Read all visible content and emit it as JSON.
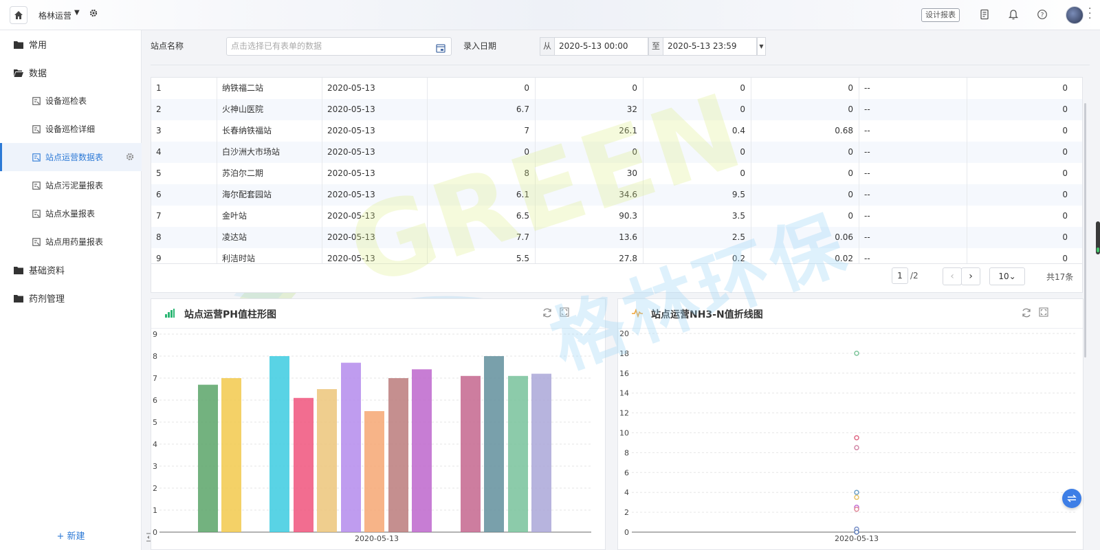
{
  "topbar": {
    "app_name": "格林运营",
    "design_report_label": "设计报表"
  },
  "sidebar": {
    "groups": [
      {
        "label": "常用",
        "icon": "folder-icon"
      },
      {
        "label": "数据",
        "icon": "folder-open-icon"
      },
      {
        "label": "基础资料",
        "icon": "folder-icon"
      },
      {
        "label": "药剂管理",
        "icon": "folder-icon"
      }
    ],
    "items": [
      {
        "label": "设备巡检表",
        "active": false
      },
      {
        "label": "设备巡检详细",
        "active": false
      },
      {
        "label": "站点运营数据表",
        "active": true
      },
      {
        "label": "站点污泥量报表",
        "active": false
      },
      {
        "label": "站点水量报表",
        "active": false
      },
      {
        "label": "站点用药量报表",
        "active": false
      }
    ],
    "new_label": "+ 新建"
  },
  "filter": {
    "station_label": "站点名称",
    "station_placeholder": "点击选择已有表单的数据",
    "date_label": "录入日期",
    "from_prefix": "从",
    "from_value": "2020-5-13 00:00",
    "to_prefix": "至",
    "to_value": "2020-5-13 23:59"
  },
  "table": {
    "rows": [
      [
        "1",
        "纳铁福二站",
        "2020-05-13",
        "0",
        "0",
        "0",
        "0",
        "--",
        "0"
      ],
      [
        "2",
        "火神山医院",
        "2020-05-13",
        "6.7",
        "32",
        "0",
        "0",
        "--",
        "0"
      ],
      [
        "3",
        "长春纳铁福站",
        "2020-05-13",
        "7",
        "26.1",
        "0.4",
        "0.68",
        "--",
        "0"
      ],
      [
        "4",
        "白沙洲大市场站",
        "2020-05-13",
        "0",
        "0",
        "0",
        "0",
        "--",
        "0"
      ],
      [
        "5",
        "苏泊尔二期",
        "2020-05-13",
        "8",
        "30",
        "0",
        "0",
        "--",
        "0"
      ],
      [
        "6",
        "海尔配套园站",
        "2020-05-13",
        "6.1",
        "34.6",
        "9.5",
        "0",
        "--",
        "0"
      ],
      [
        "7",
        "金叶站",
        "2020-05-13",
        "6.5",
        "90.3",
        "3.5",
        "0",
        "--",
        "0"
      ],
      [
        "8",
        "凌达站",
        "2020-05-13",
        "7.7",
        "13.6",
        "2.5",
        "0.06",
        "--",
        "0"
      ],
      [
        "9",
        "利洁时站",
        "2020-05-13",
        "5.5",
        "27.8",
        "0.2",
        "0.02",
        "--",
        "0"
      ]
    ],
    "pager": {
      "current_page": "1",
      "total_pages": "/2",
      "page_size": "10",
      "total_label": "共17条"
    }
  },
  "watermark": {
    "latin": "GREEN",
    "chinese": "格林环保"
  },
  "chart_data": [
    {
      "type": "bar",
      "title": "站点运营PH值柱形图",
      "categories": [
        "2020-05-13"
      ],
      "ylim": [
        0,
        9
      ],
      "yticks": [
        "0",
        "1",
        "2",
        "3",
        "4",
        "5",
        "6",
        "7",
        "8",
        "9"
      ],
      "grid": true,
      "values": [
        6.7,
        7,
        8,
        6.1,
        6.5,
        7.7,
        5.5,
        7,
        7.4,
        7.1,
        8,
        7.1,
        7.2
      ],
      "bar_colors": [
        "#5aa469",
        "#f2c94c",
        "#3ccbe0",
        "#f0537d",
        "#ecc67a",
        "#b48bec",
        "#f6a773",
        "#bb7b7b",
        "#bd66cc",
        "#c4668e",
        "#628f9c",
        "#78c29b",
        "#aaa7d8"
      ]
    },
    {
      "type": "scatter",
      "title": "站点运营NH3-N值折线图",
      "categories": [
        "2020-05-13"
      ],
      "ylim": [
        0,
        20
      ],
      "yticks": [
        "0",
        "2",
        "4",
        "6",
        "8",
        "10",
        "12",
        "14",
        "16",
        "18",
        "20"
      ],
      "grid": true,
      "values": [
        18,
        9.5,
        8.5,
        4,
        3.5,
        2.5,
        2.3,
        0.3,
        0
      ],
      "point_colors": [
        "#7cc49a",
        "#e06a86",
        "#d28aa8",
        "#6aa0c8",
        "#e6c46a",
        "#c26cd4",
        "#e08898",
        "#7a90c8",
        "#5a7ab8"
      ]
    }
  ]
}
